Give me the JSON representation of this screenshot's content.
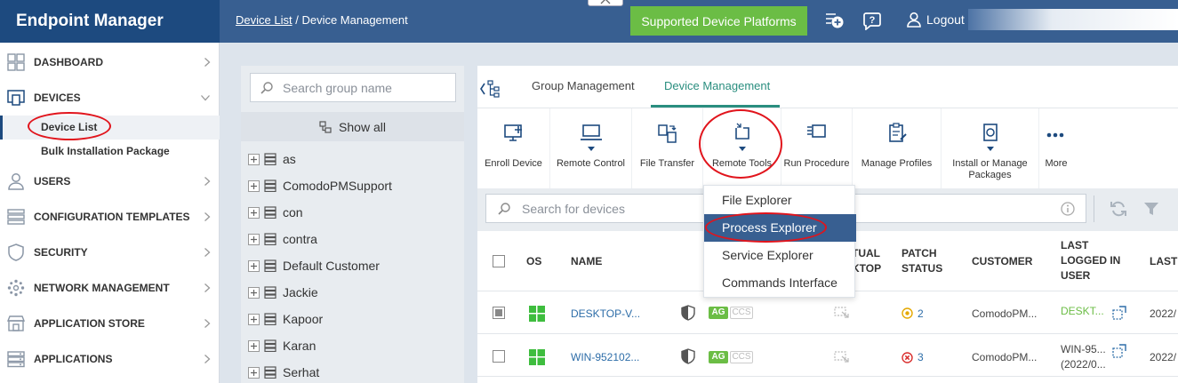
{
  "app": {
    "title": "Endpoint Manager"
  },
  "breadcrumb": {
    "link": "Device List",
    "separator": "/",
    "current": "Device Management"
  },
  "topbar": {
    "platforms_button": "Supported Device Platforms",
    "logout": "Logout",
    "add_icon": "add-device-icon",
    "help_icon": "help-icon",
    "user_icon": "user-icon"
  },
  "sidebar": {
    "items": [
      {
        "label": "DASHBOARD",
        "icon": "dashboard-icon"
      },
      {
        "label": "DEVICES",
        "icon": "devices-icon"
      },
      {
        "label": "USERS",
        "icon": "user-icon"
      },
      {
        "label": "CONFIGURATION TEMPLATES",
        "icon": "templates-icon"
      },
      {
        "label": "SECURITY",
        "icon": "shield-icon"
      },
      {
        "label": "NETWORK MANAGEMENT",
        "icon": "network-icon"
      },
      {
        "label": "APPLICATION STORE",
        "icon": "store-icon"
      },
      {
        "label": "APPLICATIONS",
        "icon": "applications-icon"
      }
    ],
    "sub_items": [
      "Device List",
      "Bulk Installation Package"
    ]
  },
  "groups": {
    "search_placeholder": "Search group name",
    "show_all": "Show all",
    "items": [
      "as",
      "ComodoPMSupport",
      "con",
      "contra",
      "Default Customer",
      "Jackie",
      "Kapoor",
      "Karan",
      "Serhat"
    ]
  },
  "tabs": [
    "Group Management",
    "Device Management"
  ],
  "toolbar": [
    "Enroll Device",
    "Remote Control",
    "File Transfer",
    "Remote Tools",
    "Run Procedure",
    "Manage Profiles",
    "Install or Manage",
    "Packages",
    "More"
  ],
  "remote_tools_menu": {
    "items": [
      "File Explorer",
      "Process Explorer",
      "Service Explorer",
      "Commands Interface"
    ],
    "selected": "Process Explorer"
  },
  "device_search": {
    "placeholder": "Search for devices"
  },
  "table": {
    "headers": {
      "os": "OS",
      "name": "NAME",
      "virtual_a": "TUAL",
      "virtual_b": "KTOP",
      "patch_a": "PATCH",
      "patch_b": "STATUS",
      "customer": "CUSTOMER",
      "last_a": "LAST",
      "last_b": "LOGGED IN",
      "last_c": "USER",
      "last2": "LAST"
    },
    "rows": [
      {
        "name": "DESKTOP-V...",
        "badge_ag": "AG",
        "badge_ccs": "CCS",
        "patch_count": "2",
        "patch_color": "#e5a800",
        "customer": "ComodoPM...",
        "user_line1": "DESKT...",
        "user_line2": "",
        "last": "2022/"
      },
      {
        "name": "WIN-952102...",
        "badge_ag": "AG",
        "badge_ccs": "CCS",
        "patch_count": "3",
        "patch_color": "#d9302f",
        "customer": "ComodoPM...",
        "user_line1": "WIN-95...",
        "user_line2": "(2022/0...",
        "last": "2022/"
      }
    ]
  },
  "colors": {
    "brand": "#1d4a7f",
    "topbar": "#385f91",
    "accent": "#2a8e7f",
    "button_green": "#6bbd45",
    "annotation": "#e1141c"
  }
}
